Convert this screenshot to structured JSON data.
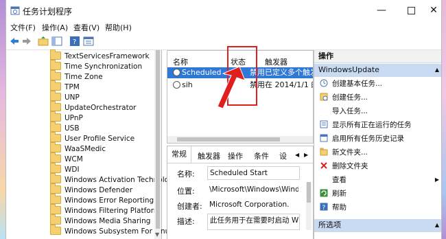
{
  "window": {
    "title": "任务计划程序"
  },
  "menu": [
    "文件(F)",
    "操作(A)",
    "查看(V)",
    "帮助(H)"
  ],
  "tree_items": [
    "TextServicesFramework",
    "Time Synchronization",
    "Time Zone",
    "TPM",
    "UNP",
    "UpdateOrchestrator",
    "UPnP",
    "USB",
    "User Profile Service",
    "WaaSMedic",
    "WCM",
    "WDI",
    "Windows Activation Technolo",
    "Windows Defender",
    "Windows Error Reporting",
    "Windows Filtering Platform",
    "Windows Media Sharing",
    "Windows Subsystem For Linux"
  ],
  "task_list": {
    "headers": [
      "名称",
      "状态",
      "触发器"
    ],
    "rows": [
      {
        "name": "Scheduled ...",
        "status": "禁用",
        "trigger": "已定义多个触发"
      },
      {
        "name": "sih",
        "status": "禁用",
        "trigger": "在 2014/1/1 的"
      }
    ]
  },
  "detail": {
    "tabs": [
      "常规",
      "触发器",
      "操作",
      "条件",
      "设"
    ],
    "fields": [
      {
        "label": "名称:",
        "value": "Scheduled Start"
      },
      {
        "label": "位置:",
        "value": "\\Microsoft\\Windows\\Window"
      },
      {
        "label": "创建者:",
        "value": "Microsoft Corporation."
      },
      {
        "label": "描述:",
        "value": "此任务用于在需要时启动 Wi"
      }
    ]
  },
  "actions": {
    "header": "操作",
    "section": "WindowsUpdate",
    "items": [
      {
        "label": "创建基本任务...",
        "icon": "create-basic-task-icon"
      },
      {
        "label": "创建任务...",
        "icon": "create-task-icon"
      },
      {
        "label": "导入任务...",
        "icon": ""
      },
      {
        "label": "显示所有正在运行的任务",
        "icon": "running-tasks-icon"
      },
      {
        "label": "启用所有任务历史记录",
        "icon": "history-icon"
      },
      {
        "label": "新文件夹...",
        "icon": "new-folder-icon"
      },
      {
        "label": "删除文件夹",
        "icon": "delete-icon"
      },
      {
        "label": "查看",
        "icon": ""
      },
      {
        "label": "刷新",
        "icon": "refresh-icon"
      },
      {
        "label": "帮助",
        "icon": "help-icon"
      }
    ],
    "footer": "所选项"
  },
  "colors": {
    "selection": "#2f78d6",
    "annotation": "#e01e1e"
  }
}
